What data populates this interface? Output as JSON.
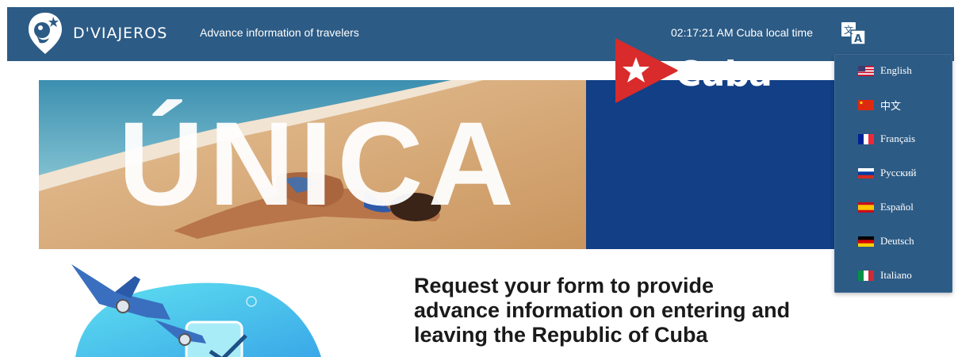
{
  "header": {
    "brand": "D'VIAJEROS",
    "tagline": "Advance information of travelers",
    "clock": "02:17:21 AM Cuba local time",
    "translate_icon": "translate-icon",
    "logo_icon": "dviajeros-logo-icon",
    "background_color": "#2c5b85"
  },
  "hero": {
    "word": "ÚNICA",
    "brand_text": "Cuba",
    "brand_icon": "cuba-star-logo-icon",
    "blue_color": "#123f85"
  },
  "main": {
    "headline_lines": [
      "Request your form to provide",
      "advance information on entering and",
      "leaving the Republic of Cuba"
    ],
    "illustration_icon": "airplane-phone-illustration-icon"
  },
  "language_menu": {
    "items": [
      {
        "label": "English",
        "flag": "us-flag-icon"
      },
      {
        "label": "中文",
        "flag": "china-flag-icon"
      },
      {
        "label": "Français",
        "flag": "france-flag-icon"
      },
      {
        "label": "Русский",
        "flag": "russia-flag-icon"
      },
      {
        "label": "Español",
        "flag": "spain-flag-icon"
      },
      {
        "label": "Deutsch",
        "flag": "germany-flag-icon"
      },
      {
        "label": "Italiano",
        "flag": "italy-flag-icon"
      }
    ]
  }
}
